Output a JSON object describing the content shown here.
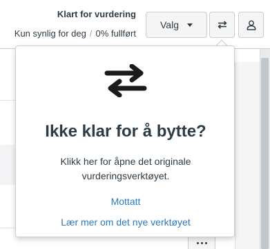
{
  "header": {
    "status_title": "Klart for vurdering",
    "visibility": "Kun synlig for deg",
    "separator": "/",
    "progress": "0% fullført",
    "options_label": "Valg",
    "swap_icon": "swap-arrows-icon",
    "user_icon": "user-icon"
  },
  "popover": {
    "icon": "swap-arrows-icon",
    "title": "Ikke klar for å bytte?",
    "body": "Klikk her for åpne det originale vurderingsverktøyet.",
    "link_primary": "Mottatt",
    "link_secondary": "Lær mer om det nye verktøyet"
  },
  "colors": {
    "text": "#2d3b45",
    "link": "#2b7abc",
    "border": "#c7cdd1",
    "button_bg": "#f5f5f5"
  }
}
